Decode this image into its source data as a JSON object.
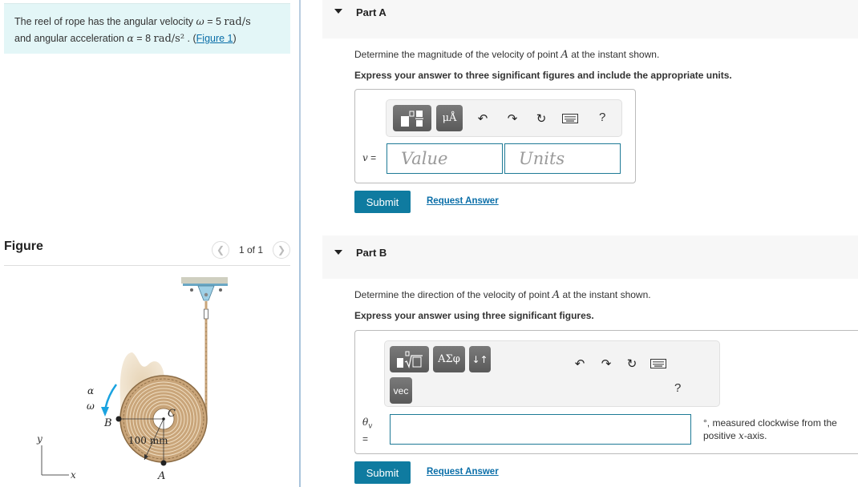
{
  "problem": {
    "text_prefix": "The reel of rope has the angular velocity ",
    "omega_symbol": "ω",
    "omega_eq": " = 5 ",
    "omega_unit": "rad/s",
    "line2_prefix": "and angular acceleration ",
    "alpha_symbol": "α",
    "alpha_eq": " = 8 ",
    "alpha_unit": "rad/s²",
    "link_prefix": " . (",
    "figure_link": "Figure 1",
    "link_suffix": ")"
  },
  "figure": {
    "title": "Figure",
    "pager_label": "1 of 1",
    "prev_icon": "chevron-left-icon",
    "next_icon": "chevron-right-icon",
    "labels": {
      "alpha": "α",
      "omega": "ω",
      "B": "B",
      "C": "C",
      "A": "A",
      "dimension": "100 mm",
      "y_axis": "y",
      "x_axis": "x"
    },
    "colors": {
      "rope": "#c9a57a",
      "reel_dark": "#8a6a43",
      "reel_light": "#e9d4b4",
      "arrow": "#1aa3e0",
      "bracket": "#9fd0e6"
    }
  },
  "partA": {
    "title": "Part A",
    "question_prefix": "Determine the magnitude of the velocity of point ",
    "question_var": "A",
    "question_suffix": " at the instant shown.",
    "instruction": "Express your answer to three significant figures and include the appropriate units.",
    "toolbar": {
      "templates_icon": "templates-icon",
      "units_label": "μÅ",
      "undo_icon": "undo-icon",
      "redo_icon": "redo-icon",
      "reset_icon": "reset-icon",
      "keyboard_icon": "keyboard-icon",
      "help_label": "?"
    },
    "var_label": "v",
    "eq_label": " =",
    "value_placeholder": "Value",
    "units_placeholder": "Units",
    "submit_label": "Submit",
    "request_label": "Request Answer"
  },
  "partB": {
    "title": "Part B",
    "question_prefix": "Determine the direction of the velocity of point ",
    "question_var": "A",
    "question_suffix": " at the instant shown.",
    "instruction": "Express your answer using three significant figures.",
    "toolbar": {
      "templates_icon": "templates-radical-icon",
      "greek_label": "ΑΣφ",
      "sort_label": "↓↑",
      "vec_label": "vec",
      "undo_icon": "undo-icon",
      "redo_icon": "redo-icon",
      "reset_icon": "reset-icon",
      "keyboard_icon": "keyboard-icon",
      "help_label": "?"
    },
    "var_label": "θ",
    "var_sub": "v",
    "eq_label": "=",
    "input_value": "",
    "note_line1": "°, measured clockwise from the",
    "note_line2_prefix": "positive ",
    "note_var": "x",
    "note_line2_suffix": "-axis.",
    "submit_label": "Submit",
    "request_label": "Request Answer"
  },
  "colors": {
    "accent": "#0f7ba0",
    "link": "#0a6ea8",
    "problem_bg": "#e3f6f7",
    "part_header_bg": "#f7f7f7",
    "input_border": "#1e7a96"
  }
}
